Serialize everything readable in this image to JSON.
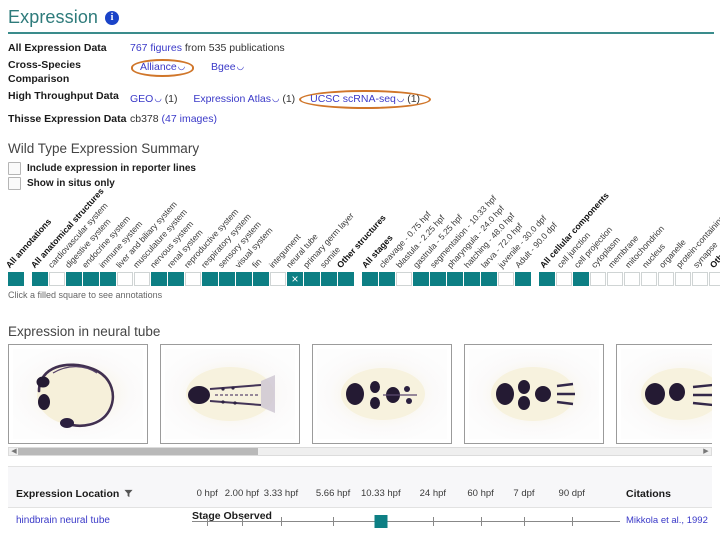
{
  "header": {
    "title": "Expression",
    "info_icon": "info-icon",
    "accent_color": "#2e7b7b"
  },
  "summary": {
    "rows": [
      {
        "label": "All Expression Data",
        "link": "767 figures",
        "suffix": "from 535 publications"
      },
      {
        "label": "Cross-Species Comparison",
        "links": [
          "Alliance",
          "Bgee"
        ],
        "highlighted": [
          "Alliance"
        ]
      },
      {
        "label": "High Throughput Data",
        "items": [
          {
            "link": "GEO",
            "count": "(1)"
          },
          {
            "link": "Expression Atlas",
            "count": "(1)"
          },
          {
            "link": "UCSC scRNA-seq",
            "count": "(1)"
          }
        ],
        "highlighted": [
          "UCSC scRNA-seq"
        ]
      },
      {
        "label": "Thisse Expression Data",
        "prefix": "cb378",
        "link": "(47 images)"
      }
    ]
  },
  "wild_type": {
    "section_title": "Wild Type Expression Summary",
    "checkboxes": [
      {
        "label": "Include expression in reporter lines",
        "checked": false
      },
      {
        "label": "Show in situs only",
        "checked": false
      }
    ],
    "hint": "Click a filled square to see annotations",
    "cell_color_on": "#0d7f84",
    "cell_color_off": "#ffffff",
    "ribbon": [
      {
        "label": "All annotations",
        "bold": true,
        "state": "on",
        "gap_after": true
      },
      {
        "label": "All anatomical structures",
        "bold": true,
        "state": "on",
        "gap_after": false
      },
      {
        "label": "cardiovascular system",
        "bold": false,
        "state": "off",
        "gap_after": false
      },
      {
        "label": "digestive system",
        "bold": false,
        "state": "on",
        "gap_after": false
      },
      {
        "label": "endocrine system",
        "bold": false,
        "state": "on",
        "gap_after": false
      },
      {
        "label": "immune system",
        "bold": false,
        "state": "on",
        "gap_after": false
      },
      {
        "label": "liver and biliary system",
        "bold": false,
        "state": "off",
        "gap_after": false
      },
      {
        "label": "musculature system",
        "bold": false,
        "state": "off",
        "gap_after": false
      },
      {
        "label": "nervous system",
        "bold": false,
        "state": "on",
        "gap_after": false
      },
      {
        "label": "renal system",
        "bold": false,
        "state": "on",
        "gap_after": false
      },
      {
        "label": "reproductive system",
        "bold": false,
        "state": "off",
        "gap_after": false
      },
      {
        "label": "respiratory system",
        "bold": false,
        "state": "on",
        "gap_after": false
      },
      {
        "label": "sensory system",
        "bold": false,
        "state": "on",
        "gap_after": false
      },
      {
        "label": "visual system",
        "bold": false,
        "state": "on",
        "gap_after": false
      },
      {
        "label": "fin",
        "bold": false,
        "state": "on",
        "gap_after": false
      },
      {
        "label": "integument",
        "bold": false,
        "state": "off",
        "gap_after": false
      },
      {
        "label": "neural tube",
        "bold": false,
        "state": "selected",
        "gap_after": false
      },
      {
        "label": "primary germ layer",
        "bold": false,
        "state": "on",
        "gap_after": false
      },
      {
        "label": "somite",
        "bold": false,
        "state": "on",
        "gap_after": false
      },
      {
        "label": "Other structures",
        "bold": true,
        "state": "on",
        "gap_after": true
      },
      {
        "label": "All stages",
        "bold": true,
        "state": "on",
        "gap_after": false
      },
      {
        "label": "cleavage - 0.75 hpf",
        "bold": false,
        "state": "on",
        "gap_after": false
      },
      {
        "label": "blastula - 2.25 hpf",
        "bold": false,
        "state": "off",
        "gap_after": false
      },
      {
        "label": "gastrula - 5.25 hpf",
        "bold": false,
        "state": "on",
        "gap_after": false
      },
      {
        "label": "segmentation - 10.33 hpf",
        "bold": false,
        "state": "on",
        "gap_after": false
      },
      {
        "label": "pharyngula - 24.0 hpf",
        "bold": false,
        "state": "on",
        "gap_after": false
      },
      {
        "label": "hatching - 48.0 hpf",
        "bold": false,
        "state": "on",
        "gap_after": false
      },
      {
        "label": "larva - 72.0 hpf",
        "bold": false,
        "state": "on",
        "gap_after": false
      },
      {
        "label": "juvenile - 30.0 dpf",
        "bold": false,
        "state": "off",
        "gap_after": false
      },
      {
        "label": "Adult - 90.0 dpf",
        "bold": false,
        "state": "on",
        "gap_after": true
      },
      {
        "label": "All cellular components",
        "bold": true,
        "state": "on",
        "gap_after": false
      },
      {
        "label": "cell junction",
        "bold": false,
        "state": "off",
        "gap_after": false
      },
      {
        "label": "cell projection",
        "bold": false,
        "state": "on",
        "gap_after": false
      },
      {
        "label": "cytoplasm",
        "bold": false,
        "state": "off",
        "gap_after": false
      },
      {
        "label": "membrane",
        "bold": false,
        "state": "off",
        "gap_after": false
      },
      {
        "label": "mitochondrion",
        "bold": false,
        "state": "off",
        "gap_after": false
      },
      {
        "label": "nucleus",
        "bold": false,
        "state": "off",
        "gap_after": false
      },
      {
        "label": "organelle",
        "bold": false,
        "state": "off",
        "gap_after": false
      },
      {
        "label": "protein-containing complex",
        "bold": false,
        "state": "off",
        "gap_after": false
      },
      {
        "label": "synapse",
        "bold": false,
        "state": "off",
        "gap_after": false
      },
      {
        "label": "Other cellular components",
        "bold": true,
        "state": "off",
        "gap_after": false
      }
    ]
  },
  "images": {
    "section_title": "Expression in neural tube",
    "count": 5,
    "scroll_position": "left"
  },
  "table": {
    "col_location": "Expression Location",
    "filter_icon": "filter-icon",
    "col_stage_group": "Stage Observed",
    "col_citations": "Citations",
    "stage_ticks": [
      "0 hpf",
      "2.00 hpf",
      "3.33 hpf",
      "5.66 hpf",
      "10.33 hpf",
      "24 hpf",
      "60 hpf",
      "7 dpf",
      "90 dpf"
    ],
    "rows": [
      {
        "location": "hindbrain neural tube",
        "citation": "Mikkola et al., 1992",
        "marker_index": 4
      }
    ]
  }
}
